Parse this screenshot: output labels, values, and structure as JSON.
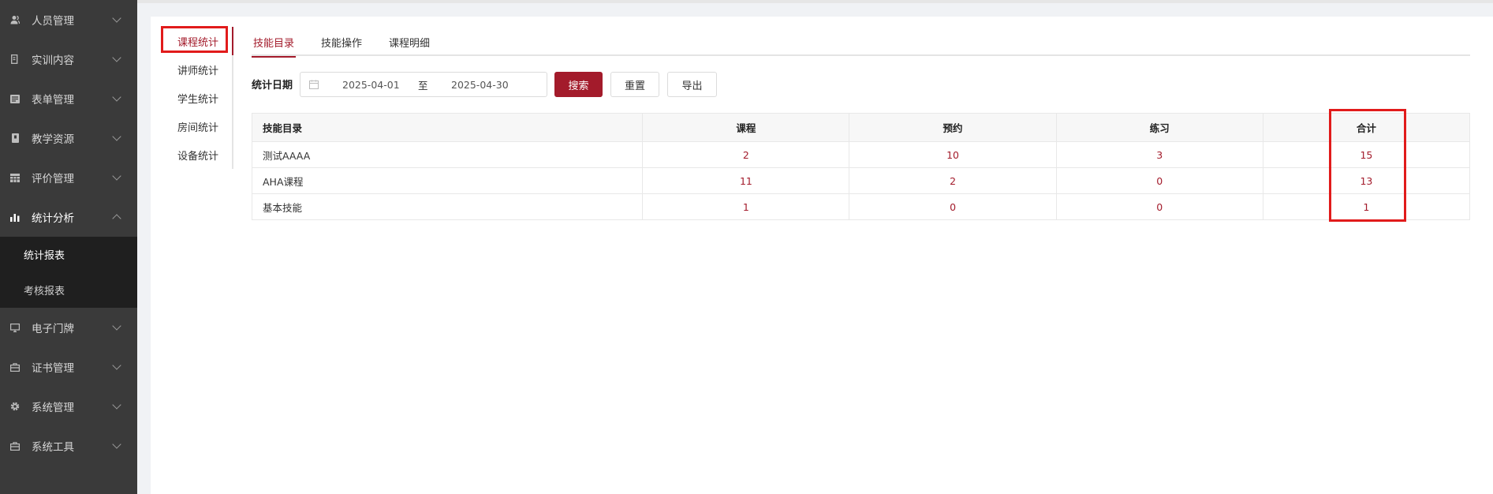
{
  "sidebar": {
    "items": [
      {
        "label": "人员管理",
        "icon": "users-icon"
      },
      {
        "label": "实训内容",
        "icon": "doc-icon"
      },
      {
        "label": "表单管理",
        "icon": "form-icon"
      },
      {
        "label": "教学资源",
        "icon": "book-icon"
      },
      {
        "label": "评价管理",
        "icon": "grid-icon"
      },
      {
        "label": "统计分析",
        "icon": "bar-chart-icon"
      },
      {
        "label": "电子门牌",
        "icon": "monitor-icon"
      },
      {
        "label": "证书管理",
        "icon": "certificate-icon"
      },
      {
        "label": "系统管理",
        "icon": "gear-icon"
      },
      {
        "label": "系统工具",
        "icon": "toolbox-icon"
      }
    ],
    "submenu": [
      {
        "label": "统计报表"
      },
      {
        "label": "考核报表"
      }
    ]
  },
  "vtabs": [
    {
      "label": "课程统计"
    },
    {
      "label": "讲师统计"
    },
    {
      "label": "学生统计"
    },
    {
      "label": "房间统计"
    },
    {
      "label": "设备统计"
    }
  ],
  "htabs": [
    {
      "label": "技能目录"
    },
    {
      "label": "技能操作"
    },
    {
      "label": "课程明细"
    }
  ],
  "filter": {
    "label": "统计日期",
    "start_date": "2025-04-01",
    "separator": "至",
    "end_date": "2025-04-30",
    "search_label": "搜索",
    "reset_label": "重置",
    "export_label": "导出"
  },
  "table": {
    "headers": [
      "技能目录",
      "课程",
      "预约",
      "练习",
      "合计"
    ],
    "rows": [
      [
        "测试AAAA",
        "2",
        "10",
        "3",
        "15"
      ],
      [
        "AHA课程",
        "11",
        "2",
        "0",
        "13"
      ],
      [
        "基本技能",
        "1",
        "0",
        "0",
        "1"
      ]
    ]
  },
  "colors": {
    "accent": "#a31b2b",
    "sidebar_bg": "#3a3a3a",
    "submenu_bg": "#1f1f1f",
    "highlight": "#e11b1b"
  }
}
